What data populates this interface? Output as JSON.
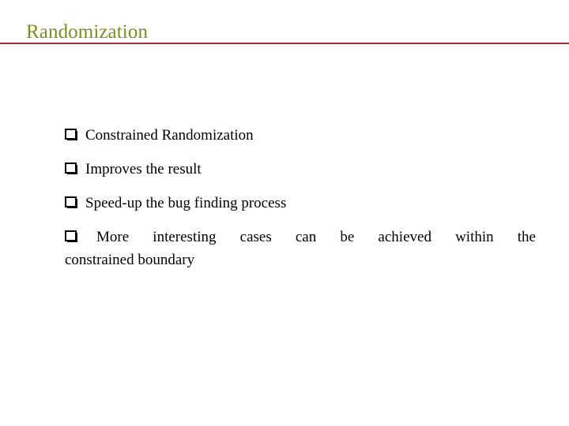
{
  "slide": {
    "title": "Randomization",
    "title_color": "#7d8c1c",
    "rule_color": "#9c3330",
    "background_color": "#ffffff",
    "text_color": "#000000",
    "bullet_glyph": "hollow-square-shadowed"
  },
  "bullets": [
    {
      "id": "bullet-1",
      "text": "Constrained Randomization",
      "wrapped": false
    },
    {
      "id": "bullet-2",
      "text": "Improves the result",
      "wrapped": false
    },
    {
      "id": "bullet-3",
      "text": "Speed-up the bug finding process",
      "wrapped": false
    },
    {
      "id": "bullet-4",
      "text": "More interesting cases can be achieved within the constrained boundary",
      "wrapped": true,
      "line_1": "More interesting cases can be achieved within the",
      "line_2": "constrained boundary"
    }
  ]
}
